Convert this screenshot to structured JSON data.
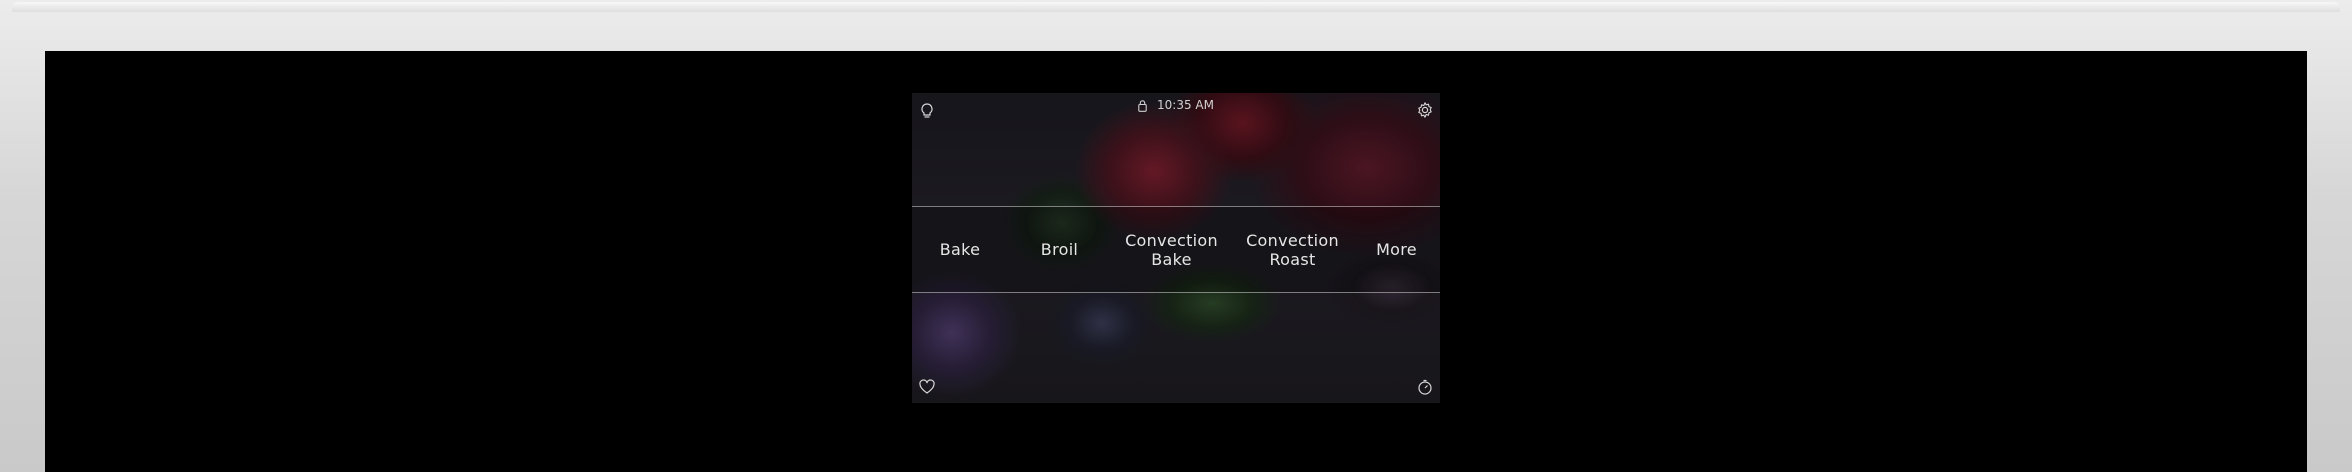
{
  "status": {
    "time": "10:35 AM",
    "lock_icon": "lock-icon"
  },
  "icons": {
    "top_left": "lightbulb-icon",
    "top_right": "gear-icon",
    "bottom_left": "heart-icon",
    "bottom_right": "timer-icon"
  },
  "modes": [
    {
      "line1": "Bake",
      "line2": ""
    },
    {
      "line1": "Broil",
      "line2": ""
    },
    {
      "line1": "Convection",
      "line2": "Bake"
    },
    {
      "line1": "Convection",
      "line2": "Roast"
    },
    {
      "line1": "More",
      "line2": ""
    }
  ],
  "colors": {
    "text": "#e6e6e6",
    "bezel": "#000000",
    "frame": "#d7d7d7"
  }
}
